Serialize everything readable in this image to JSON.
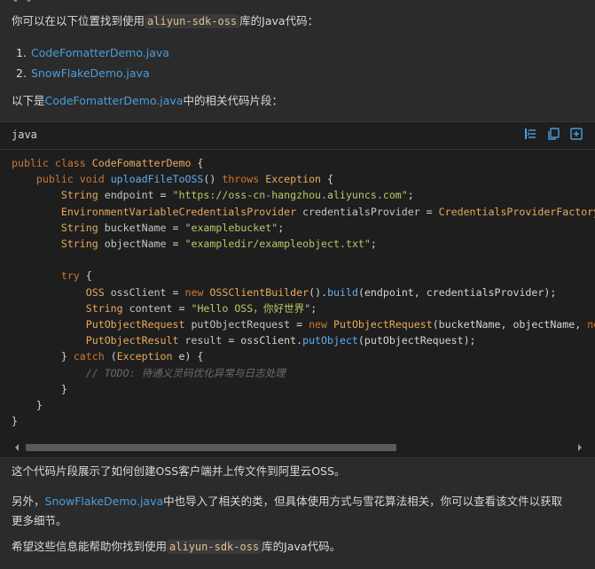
{
  "intro": {
    "before": "你可以在以下位置找到使用",
    "code": "aliyun-sdk-oss",
    "after": "库的Java代码："
  },
  "files": [
    {
      "num": "1.",
      "name": "CodeFomatterDemo.java"
    },
    {
      "num": "2.",
      "name": "SnowFlakeDemo.java"
    }
  ],
  "snippet_intro": {
    "before": "以下是",
    "link": "CodeFomatterDemo.java",
    "after": "中的相关代码片段："
  },
  "code_block": {
    "language": "java",
    "icons": [
      "wrap-lines-icon",
      "copy-icon",
      "insert-icon"
    ],
    "scroll_position": 0.0
  },
  "summary1": "这个代码片段展示了如何创建OSS客户端并上传文件到阿里云OSS。",
  "summary2": {
    "before": "另外，",
    "link": "SnowFlakeDemo.java",
    "after": "中也导入了相关的类，但具体使用方式与雪花算法相关，你可以查看该文件以获取更多细节。"
  },
  "closing": {
    "before": "希望这些信息能帮助你找到使用",
    "code": "aliyun-sdk-oss",
    "after": "库的Java代码。"
  },
  "colors": {
    "background": "#2b2b2b",
    "code_background": "#1e1e1e",
    "link": "#4a9edb",
    "keyword": "#cc7832",
    "string": "#b5c96a",
    "method": "#61afef",
    "comment": "#6b6b6b",
    "icon": "#4a9edb"
  }
}
